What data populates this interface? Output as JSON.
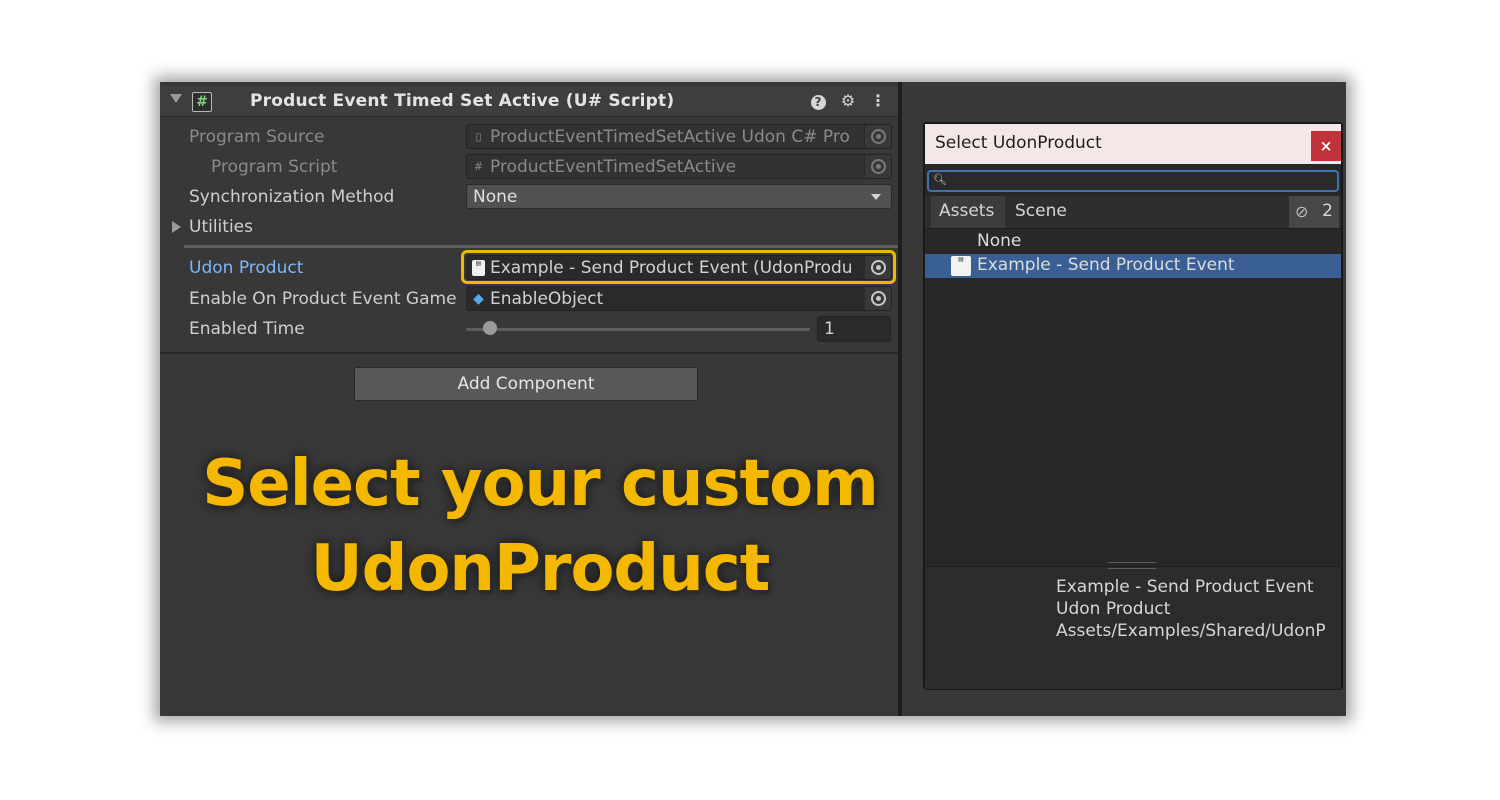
{
  "component": {
    "title": "Product Event Timed Set Active (U# Script)",
    "script_icon": "#"
  },
  "properties": {
    "program_source": {
      "label": "Program Source",
      "value": "ProductEventTimedSetActive Udon C# Pro"
    },
    "program_script": {
      "label": "Program Script",
      "value": "ProductEventTimedSetActive"
    },
    "sync_method": {
      "label": "Synchronization Method",
      "value": "None"
    },
    "utilities": {
      "label": "Utilities"
    },
    "udon_product": {
      "label": "Udon Product",
      "value": "Example - Send Product Event (UdonProdu"
    },
    "enable_object": {
      "label": "Enable On Product Event Game",
      "value": "EnableObject"
    },
    "enabled_time": {
      "label": "Enabled Time",
      "value": "1",
      "slider_fraction": 0.07
    }
  },
  "add_component_label": "Add Component",
  "overlay": {
    "line1": "Select your custom",
    "line2": "UdonProduct",
    "color": "#f5b800"
  },
  "dialog": {
    "title": "Select UdonProduct",
    "close_glyph": "×",
    "search_value": "",
    "tabs": {
      "assets": "Assets",
      "scene": "Scene"
    },
    "hidden_count": "2",
    "items": [
      {
        "label": "None"
      },
      {
        "label": "Example - Send Product Event",
        "selected": true
      }
    ],
    "preview": {
      "name": "Example - Send Product Event",
      "type": "Udon Product",
      "path": "Assets/Examples/Shared/UdonP"
    }
  },
  "colors": {
    "highlight": "#f2b705",
    "selection": "#3a5f94",
    "close": "#c1323a"
  }
}
